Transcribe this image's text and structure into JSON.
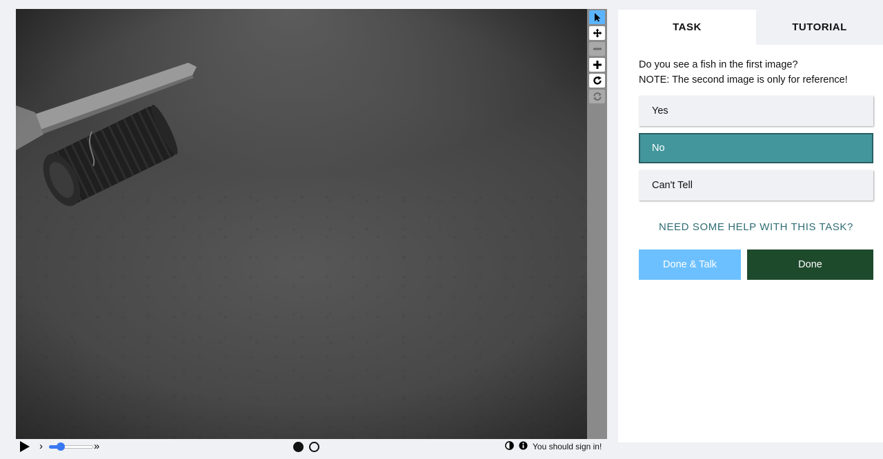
{
  "tabs": {
    "task": "TASK",
    "tutorial": "TUTORIAL"
  },
  "question": {
    "line1": "Do you see a fish in the first image?",
    "line2": "NOTE: The second image is only for reference!"
  },
  "answers": [
    {
      "label": "Yes",
      "selected": false
    },
    {
      "label": "No",
      "selected": true
    },
    {
      "label": "Can't Tell",
      "selected": false
    }
  ],
  "help_link": "NEED SOME HELP WITH THIS TASK?",
  "buttons": {
    "done_talk": "Done & Talk",
    "done": "Done"
  },
  "tools": [
    {
      "name": "pointer-icon",
      "state": "active"
    },
    {
      "name": "move-icon",
      "state": "normal"
    },
    {
      "name": "zoom-out-icon",
      "state": "disabled"
    },
    {
      "name": "zoom-in-icon",
      "state": "normal"
    },
    {
      "name": "rotate-icon",
      "state": "normal"
    },
    {
      "name": "reset-icon",
      "state": "disabled"
    }
  ],
  "controls": {
    "slower_label": "›",
    "faster_label": "»",
    "speed_level": 0.27,
    "frames": [
      {
        "filled": true
      },
      {
        "filled": false
      }
    ],
    "signin_text": "You should sign in!"
  },
  "colors": {
    "selected_answer": "#43979c",
    "done_button": "#1e4a2c",
    "done_talk_button": "#6cc0ff",
    "help_link": "#2f6c74",
    "active_tool": "#5bb4ff"
  }
}
